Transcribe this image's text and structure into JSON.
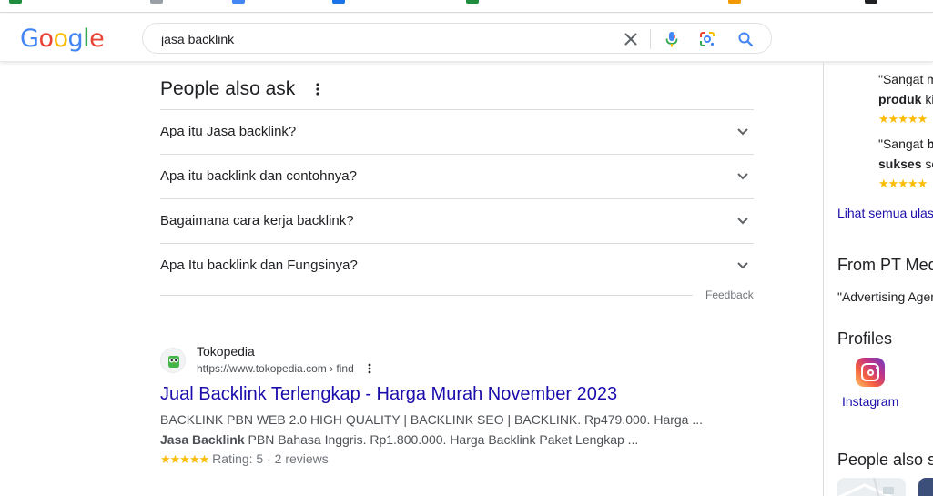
{
  "search": {
    "query": "jasa backlink"
  },
  "logo": {
    "letters": [
      "G",
      "o",
      "o",
      "g",
      "l",
      "e"
    ],
    "colors": [
      "#4285f4",
      "#ea4335",
      "#fbbc05",
      "#4285f4",
      "#34a853",
      "#ea4335"
    ]
  },
  "paa": {
    "title": "People also ask",
    "questions": [
      "Apa itu Jasa backlink?",
      "Apa itu backlink dan contohnya?",
      "Bagaimana cara kerja backlink?",
      "Apa Itu backlink dan Fungsinya?"
    ],
    "feedback": "Feedback"
  },
  "result": {
    "site_name": "Tokopedia",
    "url": "https://www.tokopedia.com › find",
    "title": "Jual Backlink Terlengkap - Harga Murah November 2023",
    "snippet_line1": "BACKLINK PBN WEB 2.0 HIGH QUALITY | BACKLINK SEO | BACKLINK. Rp479.000. Harga ...",
    "snippet_bold": "Jasa Backlink",
    "snippet_line2_rest": " PBN Bahasa Inggris. Rp1.800.000. Harga Backlink Paket Lengkap ...",
    "stars": "★★★★★",
    "rating_text": "Rating: 5 · 2 reviews"
  },
  "right_panel": {
    "review1_line1": "\"Sangat m",
    "review1_bold": "produk",
    "review1_rest": " ki",
    "review1_stars": "★★★★★",
    "review2_line1": "\"Sangat ",
    "review2_line1_bold": "b",
    "review2_bold": "sukses",
    "review2_rest": " se",
    "review2_stars": "★★★★★",
    "see_all_reviews": "Lihat semua ulas",
    "from_heading": "From PT Med",
    "from_text": "\"Advertising Agen",
    "profiles_heading": "Profiles",
    "instagram_label": "Instagram",
    "people_also_search": "People also s"
  }
}
